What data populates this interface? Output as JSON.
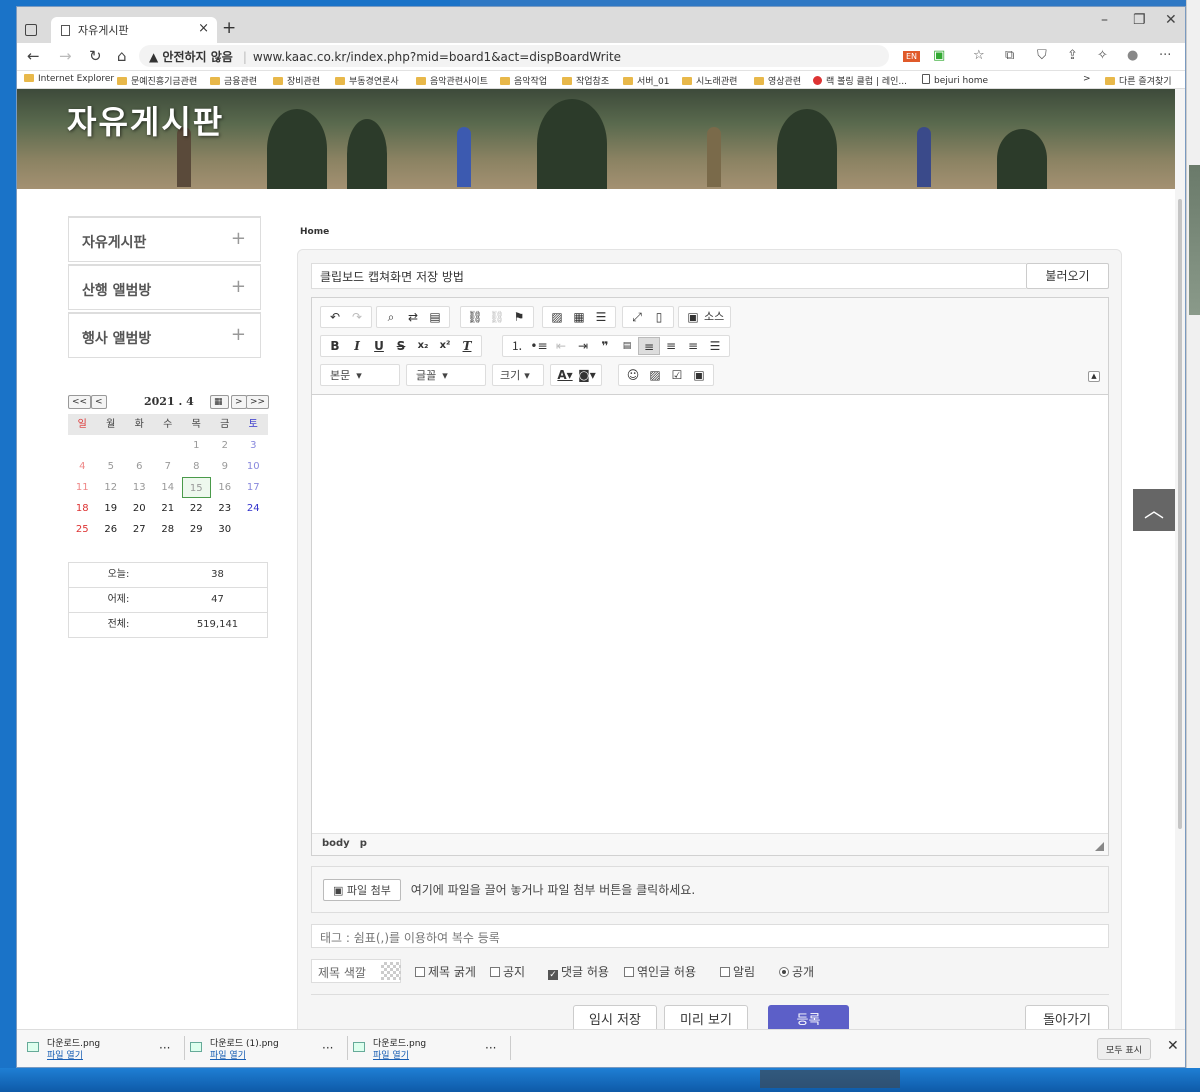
{
  "browser": {
    "tab_title": "자유게시판",
    "tab_close": "×",
    "new_tab": "+",
    "win_min": "–",
    "win_max": "❐",
    "win_close": "✕",
    "security_warning": "▲ 안전하지 않음",
    "url": "www.kaac.co.kr/index.php?mid=board1&act=dispBoardWrite",
    "bookmarks": [
      "Internet Explorer",
      "문예진흥기금관련",
      "금융관련",
      "장비관련",
      "부동경연론사",
      "음악관련사이트",
      "음악작업",
      "작업참조",
      "서버_01",
      "시노래관련",
      "영상관련",
      "랙 볼링 클럽 | 레인...",
      "bejuri home"
    ],
    "bookmark_more": ">",
    "bookmark_other": "다른 즐겨찾기"
  },
  "page": {
    "hero_title": "자유게시판",
    "breadcrumb": "Home",
    "side_menu": [
      {
        "label": "자유게시판",
        "plus": "+"
      },
      {
        "label": "산행 앨범방",
        "plus": "+"
      },
      {
        "label": "행사 앨범방",
        "plus": "+"
      }
    ],
    "calendar": {
      "prev_year": "<<",
      "prev_month": "<",
      "title": "2021 . 4",
      "next_month": ">",
      "next_year": ">>",
      "dow": [
        "일",
        "월",
        "화",
        "수",
        "목",
        "금",
        "토"
      ],
      "weeks": [
        [
          "",
          "",
          "",
          "",
          "1",
          "2",
          "3"
        ],
        [
          "4",
          "5",
          "6",
          "7",
          "8",
          "9",
          "10"
        ],
        [
          "11",
          "12",
          "13",
          "14",
          "15",
          "16",
          "17"
        ],
        [
          "18",
          "19",
          "20",
          "21",
          "22",
          "23",
          "24"
        ],
        [
          "25",
          "26",
          "27",
          "28",
          "29",
          "30",
          ""
        ]
      ],
      "today": "15"
    },
    "counter": [
      {
        "label": "오늘:",
        "value": "38"
      },
      {
        "label": "어제:",
        "value": "47"
      },
      {
        "label": "전체:",
        "value": "519,141"
      }
    ],
    "form": {
      "title_value": "클립보드 캡쳐화면 저장 방법",
      "load_button": "불러오기",
      "source_button": "소스",
      "format_combo": "본문",
      "font_combo": "글꼴",
      "size_combo": "크기",
      "path_items": [
        "body",
        "p"
      ],
      "attach_button": "파일 첨부",
      "attach_hint": "여기에 파일을 끌어 놓거나 파일 첨부 버튼을 클릭하세요.",
      "tags_placeholder": "태그 : 쉼표(,)를 이용하여 복수 등록",
      "title_color": "제목 색깔",
      "options": [
        {
          "label": "제목 굵게",
          "checked": false
        },
        {
          "label": "공지",
          "checked": false
        },
        {
          "label": "댓글 허용",
          "checked": true
        },
        {
          "label": "엮인글 허용",
          "checked": false
        },
        {
          "label": "알림",
          "checked": false
        }
      ],
      "public_label": "공개",
      "btn_temp_save": "임시 저장",
      "btn_preview": "미리 보기",
      "btn_submit": "등록",
      "btn_back": "돌아가기"
    },
    "to_top": "︿"
  },
  "downloads": {
    "items": [
      {
        "name": "다운로드.png",
        "open": "파일 열기"
      },
      {
        "name": "다운로드 (1).png",
        "open": "파일 열기"
      },
      {
        "name": "다운로드.png",
        "open": "파일 열기"
      }
    ],
    "more": "···",
    "show_all": "모두 표시",
    "close": "✕"
  },
  "colors": {
    "submit_button": "#5c5fc8",
    "to_top_bg": "#666666"
  }
}
